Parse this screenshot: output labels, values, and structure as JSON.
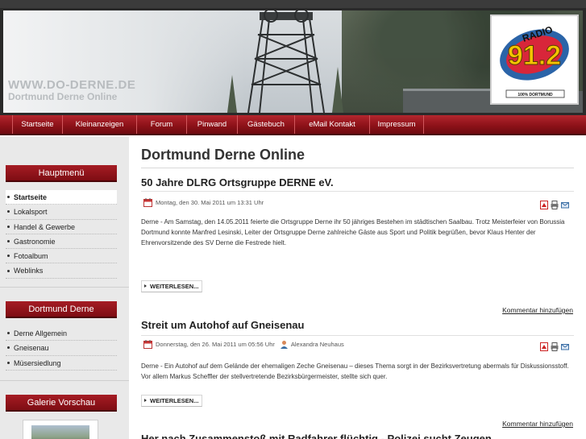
{
  "header": {
    "site_url": "WWW.DO-DERNE.DE",
    "site_name": "Dortmund Derne Online",
    "radio_logo_icon": "radio-912-logo"
  },
  "nav": {
    "items": [
      "Startseite",
      "Kleinanzeigen",
      "Forum",
      "Pinwand",
      "Gästebuch",
      "eMail Kontakt",
      "Impressum"
    ]
  },
  "sidebar": {
    "menu1": {
      "title": "Hauptmenü",
      "items": [
        {
          "label": "Startseite",
          "active": true
        },
        {
          "label": "Lokalsport",
          "active": false
        },
        {
          "label": "Handel & Gewerbe",
          "active": false
        },
        {
          "label": "Gastronomie",
          "active": false
        },
        {
          "label": "Fotoalbum",
          "active": false
        },
        {
          "label": "Weblinks",
          "active": false
        }
      ]
    },
    "menu2": {
      "title": "Dortmund Derne",
      "items": [
        {
          "label": "Derne Allgemein"
        },
        {
          "label": "Gneisenau"
        },
        {
          "label": "Müsersiedlung"
        }
      ]
    },
    "menu3": {
      "title": "Galerie Vorschau"
    }
  },
  "main": {
    "page_title": "Dortmund Derne Online",
    "articles": [
      {
        "title": "50 Jahre DLRG Ortsgruppe DERNE eV.",
        "date": "Montag, den 30. Mai 2011 um 13:31 Uhr",
        "author": "",
        "text": "Derne - Am Samstag, den 14.05.2011 feierte die Ortsgruppe Derne ihr 50 jähriges Bestehen im städtischen Saalbau. Trotz Meisterfeier von Borussia Dortmund konnte Manfred Lesinski, Leiter der Ortsgruppe Derne zahlreiche Gäste aus Sport und Politik begrüßen, bevor Klaus Henter der Ehrenvorsitzende des SV Derne die Festrede hielt.",
        "readmore": "WEITERLESEN...",
        "comment": "Kommentar hinzufügen"
      },
      {
        "title": "Streit um Autohof auf Gneisenau",
        "date": "Donnerstag, den 26. Mai 2011 um 05:56 Uhr",
        "author": "Alexandra Neuhaus",
        "text": "Derne - Ein Autohof auf dem Gelände der ehemaligen Zeche Gneisenau – dieses Thema sorgt in der Bezirksvertretung abermals für Diskussionsstoff. Vor allem Markus Scheffler der stellvertretende Bezirksbürgermeister, stellte sich quer.",
        "readmore": "WEITERLESEN...",
        "comment": "Kommentar hinzufügen"
      },
      {
        "title": "Her nach Zusammenstoß mit Radfahrer flüchtig - Polizei sucht Zeugen"
      }
    ],
    "tool_icons": [
      "pdf-icon",
      "print-icon",
      "email-icon"
    ]
  },
  "colors": {
    "nav_red": "#8e1219",
    "sidebar_bg": "#e9e9e9",
    "accent_red": "#a51c24"
  }
}
